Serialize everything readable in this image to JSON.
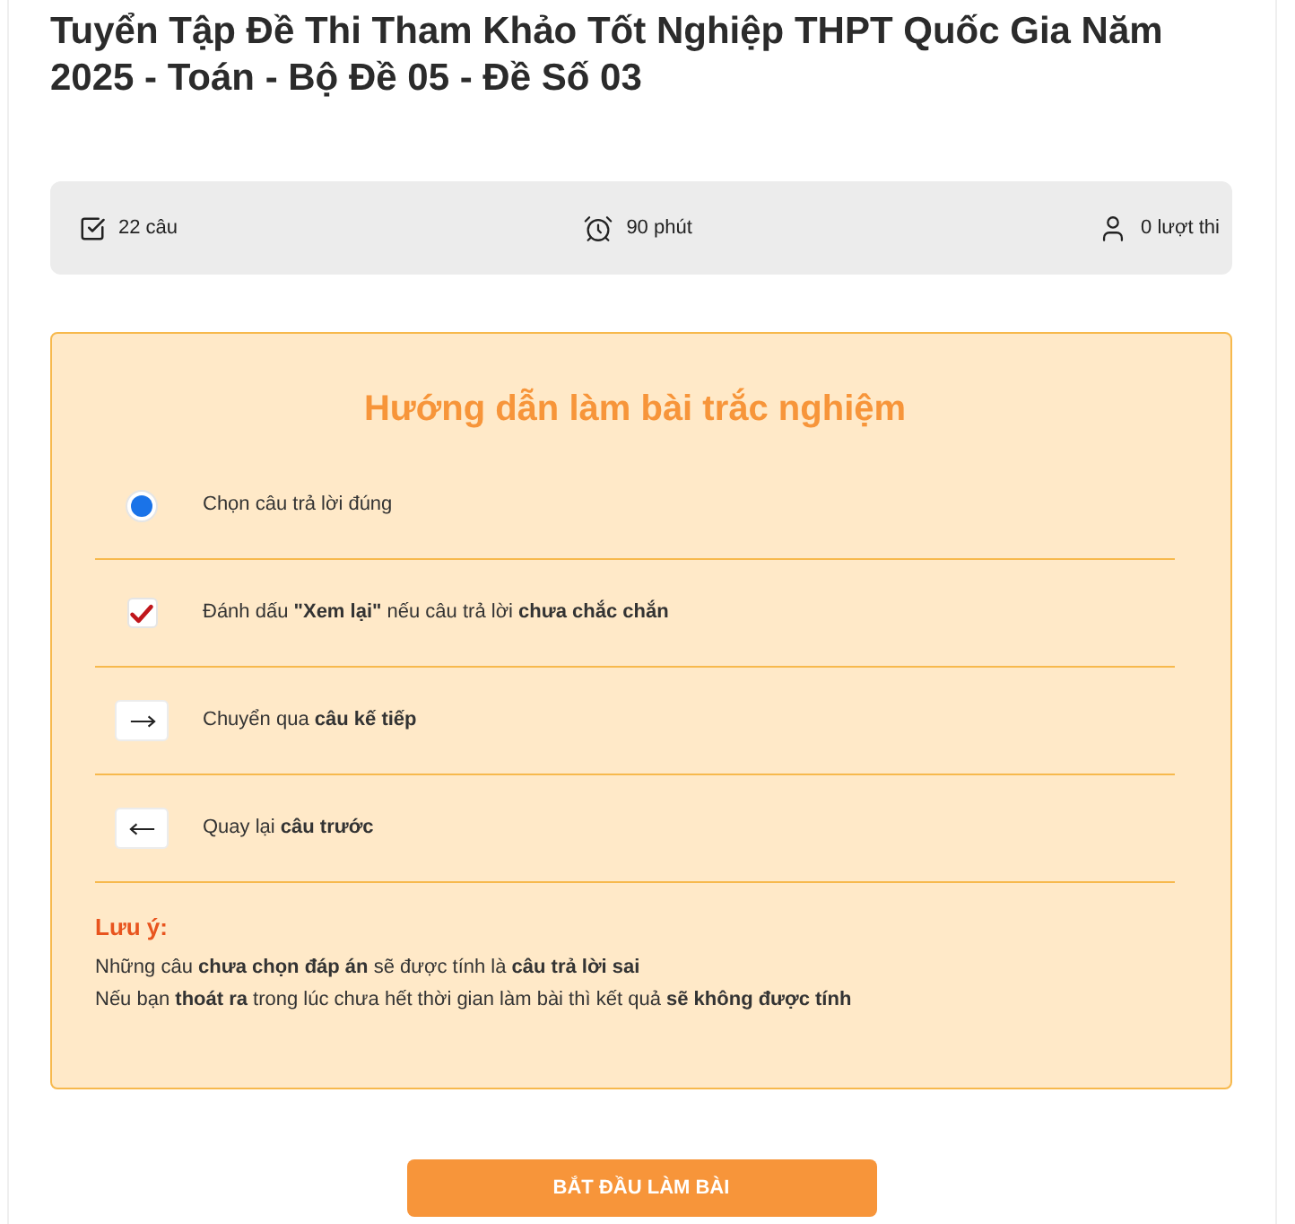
{
  "title": "Tuyển Tập Đề Thi Tham Khảo Tốt Nghiệp THPT Quốc Gia Năm 2025 - Toán - Bộ Đề 05 - Đề Số 03",
  "stats": [
    {
      "kind": "questions",
      "text": "22 câu"
    },
    {
      "kind": "time",
      "text": "90 phút"
    },
    {
      "kind": "attempts",
      "text": "0 lượt thi"
    }
  ],
  "guide": {
    "title": "Hướng dẫn làm bài trắc nghiệm",
    "items": [
      {
        "kind": "radio",
        "selected": true,
        "text": "Chọn câu trả lời đúng"
      },
      {
        "kind": "checkbox",
        "checked": true,
        "text": "Đánh dấu **\"Xem lại\"** nếu câu trả lời **chưa chắc chắn**"
      },
      {
        "kind": "next",
        "text": "Chuyển qua **câu kế tiếp**"
      },
      {
        "kind": "prev",
        "text": "Quay lại **câu trước**"
      }
    ],
    "note": {
      "label": "Lưu ý:",
      "lines": [
        "Những câu **chưa chọn đáp án** sẽ được tính là **câu trả lời sai**",
        "Nếu bạn **thoát ra** trong lúc chưa hết thời gian làm bài thì kết quả **sẽ không được tính**"
      ]
    }
  },
  "start_button": "BẮT ĐẦU LÀM BÀI"
}
